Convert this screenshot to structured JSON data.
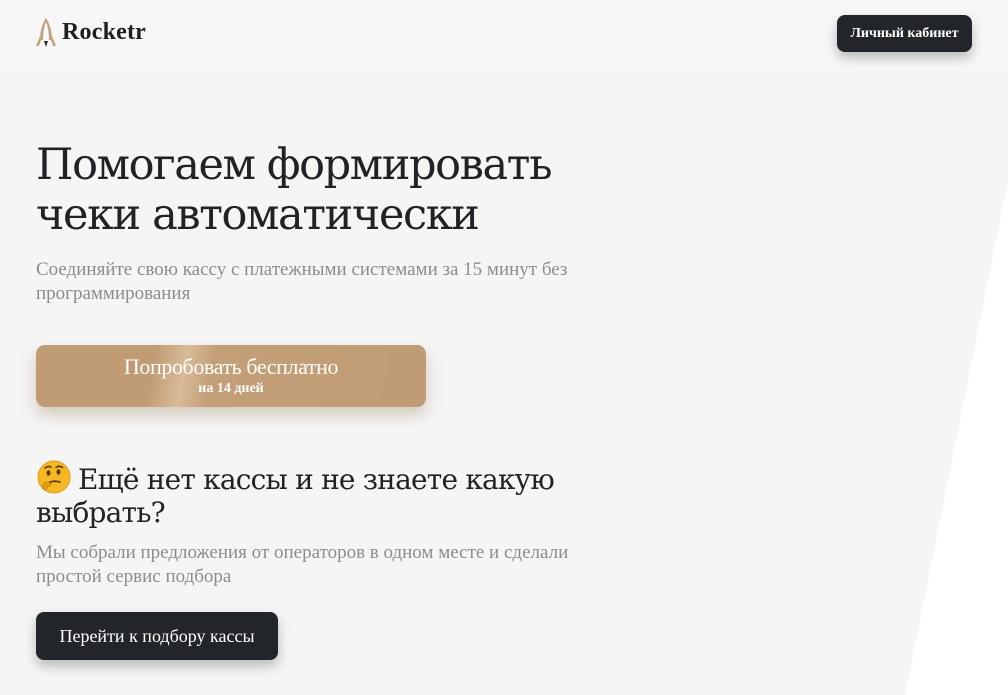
{
  "brand": {
    "name": "Rocketr",
    "logo_icon": "rocket-logo-icon",
    "logo_color": "#c4a27b"
  },
  "header": {
    "cabinet_label": "Личный кабинет"
  },
  "hero": {
    "title_line1": "Помогаем формировать",
    "title_line2": "чеки автоматически",
    "subtitle": "Соединяйте свою кассу с платежными системами за 15 минут без программирования",
    "cta_main": "Попробовать бесплатно",
    "cta_sub": "на 14 дней"
  },
  "kassa": {
    "emoji_icon": "thinking-face-icon",
    "title": "Ещё нет кассы и не знаете какую выбрать?",
    "subtitle": "Мы собрали предложения от операторов в одном месте и сделали простой сервис подбора",
    "button_label": "Перейти к подбору кассы"
  },
  "colors": {
    "background": "#f5f5f6",
    "dark_button": "#22252a",
    "accent_gold": "#c09c74",
    "muted_text": "#8c8c8f"
  }
}
